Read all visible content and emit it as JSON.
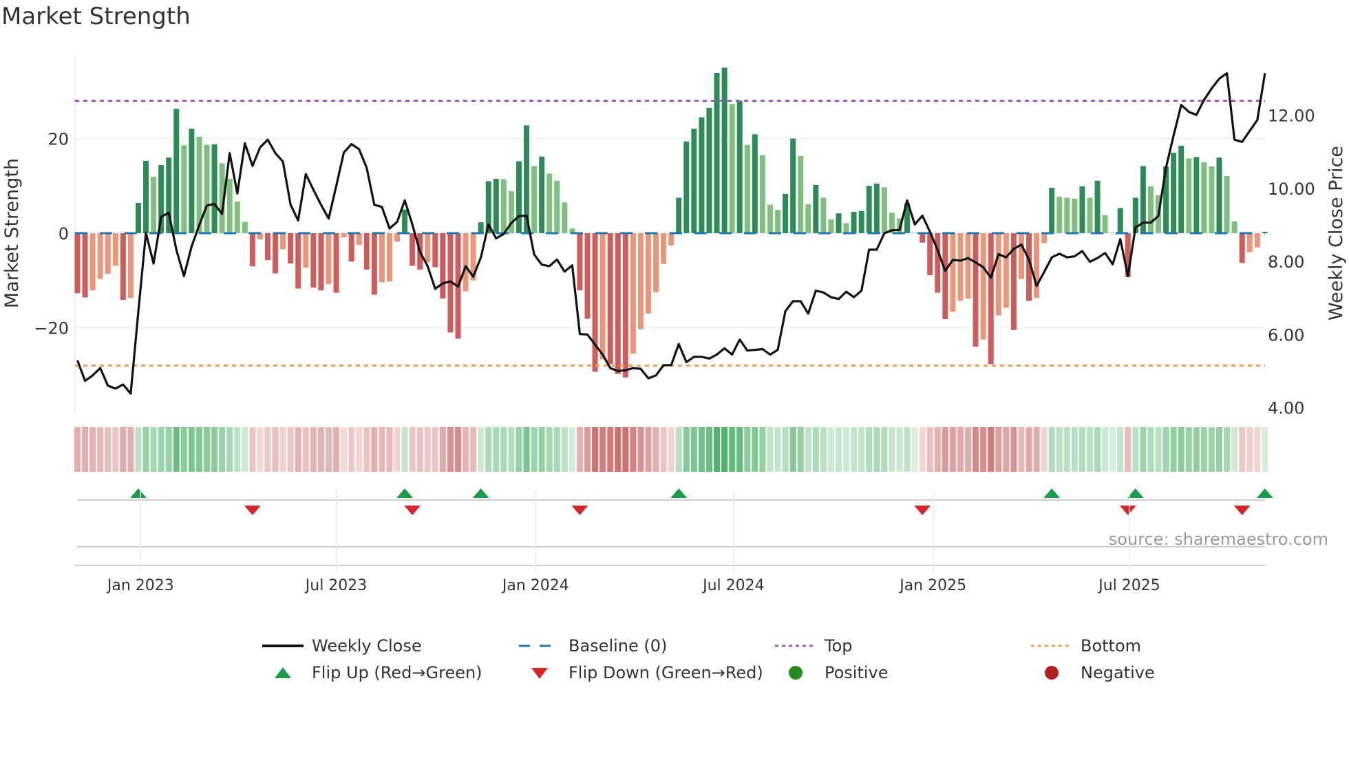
{
  "title": "Market Strength",
  "source": "source: sharemaestro.com",
  "colors": {
    "strong_green": "#2e8b57",
    "weak_green": "#80bf80",
    "strong_red": "#cd5c5c",
    "weak_red": "#e9967a",
    "close": "#111111",
    "baseline": "#1f77b4",
    "top": "#9b59d6",
    "bottom": "#f0a05a",
    "flip_up": "#1a9c4a",
    "flip_down": "#d62728",
    "positive": "#228b22",
    "negative": "#b22222"
  },
  "legend": {
    "weekly_close": "Weekly Close",
    "baseline": "Baseline (0)",
    "top": "Top",
    "bottom": "Bottom",
    "flip_up": "Flip Up (Red→Green)",
    "flip_down": "Flip Down (Green→Red)",
    "positive": "Positive",
    "negative": "Negative"
  },
  "chart_data": {
    "type": "bar",
    "title": "Market Strength",
    "ylabel": "Market Strength",
    "y2label": "Weekly Close Price",
    "ylim": [
      -36,
      38
    ],
    "y2lim": [
      3.85,
      13.75
    ],
    "yticks": [
      {
        "v": 20,
        "label": "20"
      },
      {
        "v": 0,
        "label": "0"
      },
      {
        "v": -20,
        "label": "−20"
      }
    ],
    "y2ticks": [
      {
        "v": 12,
        "label": "12.00"
      },
      {
        "v": 10,
        "label": "10.00"
      },
      {
        "v": 8,
        "label": "8.00"
      },
      {
        "v": 6,
        "label": "6.00"
      },
      {
        "v": 4,
        "label": "4.00"
      }
    ],
    "xticks": [
      {
        "week": 8.3,
        "label": "Jan 2023"
      },
      {
        "week": 34.0,
        "label": "Jul 2023"
      },
      {
        "week": 60.2,
        "label": "Jan 2024"
      },
      {
        "week": 86.2,
        "label": "Jul 2024"
      },
      {
        "week": 112.4,
        "label": "Jan 2025"
      },
      {
        "week": 138.2,
        "label": "Jul 2025"
      }
    ],
    "top": 28,
    "bottom": -28,
    "baseline": 0,
    "strength": [
      -12.7,
      -13.6,
      -12.1,
      -9.7,
      -8.6,
      -6.9,
      -14.1,
      -13.7,
      6.4,
      15.3,
      11.9,
      14.4,
      16,
      26.3,
      18.6,
      22.1,
      20.4,
      18.7,
      18.8,
      14.8,
      11.5,
      6.7,
      2.4,
      -7,
      -1.3,
      -5.7,
      -8.5,
      -3.4,
      -6.4,
      -11.7,
      -7.3,
      -11.5,
      -12.1,
      -10.8,
      -12.6,
      -0.9,
      -6,
      -2.5,
      -7.7,
      -13,
      -10.4,
      -10.2,
      -1.8,
      5,
      -6.9,
      -7.7,
      -6.2,
      -7.2,
      -13.8,
      -21,
      -22.3,
      -12.3,
      -10,
      2.3,
      11,
      11.5,
      11.4,
      8.9,
      15.2,
      22.8,
      14.2,
      16.2,
      12.6,
      11.1,
      6.5,
      1,
      -12.1,
      -18.1,
      -29.3,
      -26.7,
      -27.7,
      -29.8,
      -30.5,
      -25.5,
      -20.3,
      -17,
      -12.5,
      -6.5,
      -2.6,
      7.5,
      19.4,
      22.1,
      24.5,
      26.5,
      33.9,
      35,
      27.3,
      28,
      18.7,
      20.9,
      16.5,
      6,
      4.9,
      8.3,
      20,
      16.3,
      6.1,
      10.2,
      7.5,
      2.9,
      4.2,
      2.1,
      4.5,
      4.7,
      10,
      10.5,
      9.7,
      4.3,
      3.1,
      6.3,
      0.1,
      -2,
      -8.9,
      -12.6,
      -18.2,
      -16.6,
      -14.3,
      -13.8,
      -24,
      -22.5,
      -27.7,
      -17.4,
      -15.8,
      -20.5,
      -9.7,
      -14.3,
      -13.7,
      -2.1,
      9.6,
      7.7,
      7.5,
      7.3,
      9.9,
      7.5,
      11.1,
      3.8,
      0.1,
      5.3,
      -9.3,
      7.5,
      14.2,
      9.9,
      8,
      14.1,
      17,
      18.5,
      15.8,
      16.1,
      15,
      14.1,
      16,
      12.1,
      2.5,
      -6.3,
      -4,
      -3,
      0.3
    ],
    "close": [
      5.29,
      4.73,
      4.88,
      5.08,
      4.6,
      4.52,
      4.63,
      4.38,
      6.63,
      8.78,
      7.94,
      9.22,
      9.33,
      8.31,
      7.6,
      8.41,
      8.99,
      9.53,
      9.57,
      9.3,
      10.96,
      9.86,
      11.23,
      10.61,
      11.12,
      11.33,
      10.96,
      10.73,
      9.55,
      9.12,
      10.39,
      9.96,
      9.55,
      9.17,
      10.06,
      10.98,
      11.21,
      11.07,
      10.56,
      9.55,
      9.49,
      8.9,
      9.08,
      9.67,
      9.01,
      8.26,
      7.87,
      7.25,
      7.4,
      7.45,
      7.31,
      7.87,
      7.58,
      8.11,
      9.01,
      8.63,
      8.75,
      9.05,
      9.24,
      9.25,
      8.19,
      7.91,
      7.87,
      8.05,
      7.72,
      7.89,
      6.01,
      6.0,
      5.72,
      5.45,
      5.08,
      5.0,
      5.02,
      5.08,
      5.06,
      4.8,
      4.88,
      5.16,
      5.16,
      5.74,
      5.24,
      5.39,
      5.39,
      5.34,
      5.45,
      5.62,
      5.45,
      5.86,
      5.56,
      5.58,
      5.6,
      5.45,
      5.58,
      6.64,
      6.91,
      6.91,
      6.57,
      7.2,
      7.15,
      7.02,
      6.97,
      7.17,
      7.02,
      7.2,
      8.32,
      8.32,
      8.77,
      8.85,
      8.86,
      9.67,
      9.01,
      9.25,
      8.81,
      8.31,
      7.74,
      8.04,
      8.02,
      8.09,
      7.97,
      7.84,
      7.55,
      8.2,
      8.11,
      8.34,
      8.46,
      8.05,
      7.33,
      7.71,
      8.11,
      8.21,
      8.11,
      8.14,
      8.28,
      7.99,
      8.09,
      8.23,
      7.92,
      8.61,
      7.6,
      8.93,
      9.06,
      9.06,
      9.24,
      10.56,
      11.44,
      12.28,
      12.09,
      12.01,
      12.42,
      12.73,
      13.0,
      13.15,
      11.33,
      11.27,
      11.57,
      11.87,
      13.15
    ]
  }
}
